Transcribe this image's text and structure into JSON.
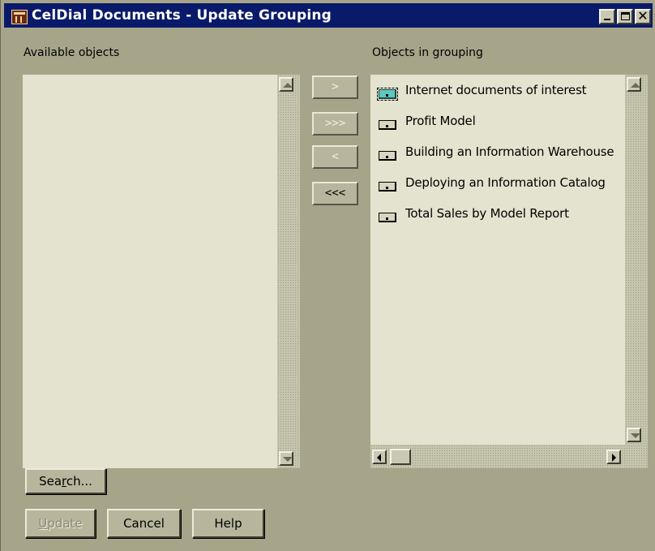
{
  "window": {
    "title": "CelDial Documents - Update Grouping",
    "controls": {
      "minimize_icon": "minimize-icon",
      "maximize_icon": "maximize-icon",
      "close_glyph": "✕"
    }
  },
  "available": {
    "label": "Available objects",
    "items": []
  },
  "grouping": {
    "label": "Objects in grouping",
    "items": [
      {
        "label": "Internet documents of interest",
        "icon": "url-document-icon",
        "selected": true
      },
      {
        "label": "Profit Model",
        "icon": "document-icon"
      },
      {
        "label": "Building an Information Warehouse",
        "icon": "document-icon"
      },
      {
        "label": "Deploying an Information Catalog",
        "icon": "document-icon"
      },
      {
        "label": "Total Sales by Model Report",
        "icon": "document-icon"
      }
    ]
  },
  "move_buttons": {
    "add_selected": ">",
    "add_all": ">>>",
    "remove_selected": "<",
    "remove_all": "<<<"
  },
  "search_button": {
    "pre": "Sea",
    "mnemonic": "r",
    "post": "ch..."
  },
  "footer": {
    "update": {
      "mnemonic": "U",
      "rest": "pdate",
      "enabled": false
    },
    "cancel": "Cancel",
    "help": "Help"
  },
  "colors": {
    "title_bar": "#0a1a6a",
    "dialog_bg": "#a6a58a",
    "list_bg": "#e4e3cf"
  }
}
